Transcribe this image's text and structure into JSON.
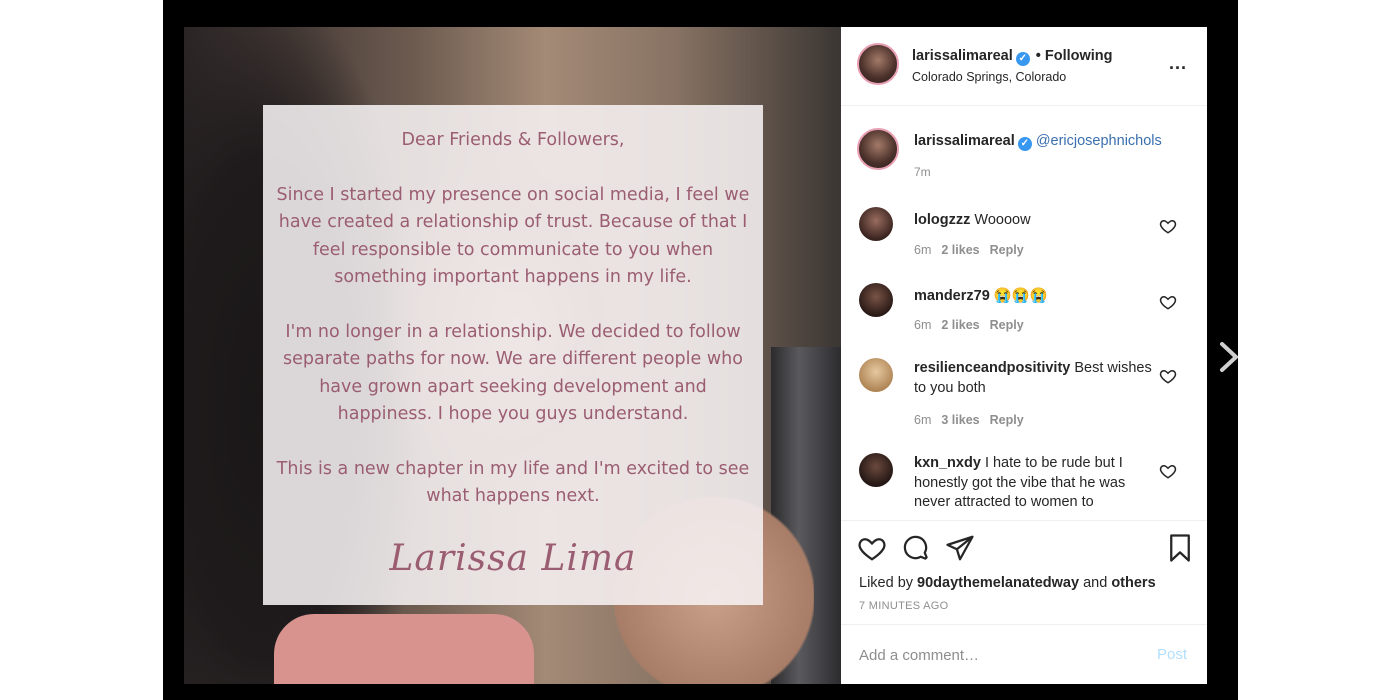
{
  "post": {
    "note": {
      "greeting": "Dear Friends & Followers,",
      "paragraph1": "Since I started my presence on social media, I feel we have created a relationship of trust. Because of that I feel responsible to communicate to you when something important happens in my life.",
      "paragraph2": "I'm no longer in a relationship. We decided to follow separate paths for now. We are different people who have grown apart seeking development and happiness. I hope you guys understand.",
      "paragraph3": "This is a new chapter in my life and I'm excited to see what happens next.",
      "signature": "Larissa Lima"
    }
  },
  "header": {
    "username": "larissalimareal",
    "verified_glyph": "✓",
    "separator": "•",
    "follow_status": "Following",
    "location": "Colorado Springs, Colorado",
    "more": "..."
  },
  "caption": {
    "username": "larissalimareal",
    "mention": "@ericjosephnichols",
    "time": "7m"
  },
  "comments": [
    {
      "username": "lologzzz",
      "text": "Woooow",
      "time": "6m",
      "likes": "2 likes",
      "reply": "Reply"
    },
    {
      "username": "manderz79",
      "text": "😭😭😭",
      "time": "6m",
      "likes": "2 likes",
      "reply": "Reply"
    },
    {
      "username": "resilienceandpositivity",
      "text": "Best wishes to you both",
      "time": "6m",
      "likes": "3 likes",
      "reply": "Reply"
    },
    {
      "username": "kxn_nxdy",
      "text": "I hate to be rude but I honestly got the vibe that he was never attracted to women to",
      "time": "",
      "likes": "",
      "reply": ""
    }
  ],
  "actions": {
    "liked_by_prefix": "Liked by",
    "liked_by_user": "90daythemelanatedway",
    "liked_by_and": "and",
    "liked_by_others": "others",
    "timestamp": "7 MINUTES AGO",
    "comment_placeholder": "Add a comment…",
    "post_label": "Post"
  },
  "icons": {
    "like": "heart-icon",
    "comment": "comment-icon",
    "share": "share-icon",
    "save": "bookmark-icon",
    "next": "chevron-right-icon"
  },
  "colors": {
    "verified": "#3897f0",
    "mention": "#3a6fb0",
    "note_text": "#9b5d72",
    "post_button": "#b2dffc"
  }
}
